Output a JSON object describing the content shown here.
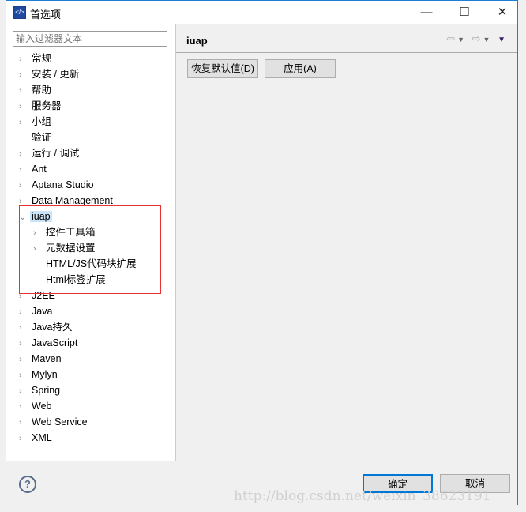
{
  "window": {
    "title": "首选项",
    "minimize": "—",
    "maximize": "☐",
    "close": "✕"
  },
  "filter": {
    "placeholder": "输入过滤器文本"
  },
  "tree": [
    {
      "label": "常规",
      "arrow": "›",
      "level": 0
    },
    {
      "label": "安装 / 更新",
      "arrow": "›",
      "level": 0
    },
    {
      "label": "帮助",
      "arrow": "›",
      "level": 0
    },
    {
      "label": "服务器",
      "arrow": "›",
      "level": 0
    },
    {
      "label": "小组",
      "arrow": "›",
      "level": 0
    },
    {
      "label": "验证",
      "arrow": "",
      "level": 0
    },
    {
      "label": "运行 / 调试",
      "arrow": "›",
      "level": 0
    },
    {
      "label": "Ant",
      "arrow": "›",
      "level": 0
    },
    {
      "label": "Aptana Studio",
      "arrow": "›",
      "level": 0
    },
    {
      "label": "Data Management",
      "arrow": "›",
      "level": 0
    },
    {
      "label": "iuap",
      "arrow": "⌄",
      "level": 0,
      "selected": true
    },
    {
      "label": "控件工具箱",
      "arrow": "›",
      "level": 1
    },
    {
      "label": "元数据设置",
      "arrow": "›",
      "level": 1
    },
    {
      "label": "HTML/JS代码块扩展",
      "arrow": "",
      "level": 1
    },
    {
      "label": "Html标签扩展",
      "arrow": "",
      "level": 1
    },
    {
      "label": "J2EE",
      "arrow": "›",
      "level": 0
    },
    {
      "label": "Java",
      "arrow": "›",
      "level": 0
    },
    {
      "label": "Java持久",
      "arrow": "›",
      "level": 0
    },
    {
      "label": "JavaScript",
      "arrow": "›",
      "level": 0
    },
    {
      "label": "Maven",
      "arrow": "›",
      "level": 0
    },
    {
      "label": "Mylyn",
      "arrow": "›",
      "level": 0
    },
    {
      "label": "Spring",
      "arrow": "›",
      "level": 0
    },
    {
      "label": "Web",
      "arrow": "›",
      "level": 0
    },
    {
      "label": "Web Service",
      "arrow": "›",
      "level": 0
    },
    {
      "label": "XML",
      "arrow": "›",
      "level": 0
    }
  ],
  "page": {
    "title": "iuap",
    "restore_defaults": "恢复默认值(D)",
    "apply": "应用(A)"
  },
  "footer": {
    "help": "?",
    "ok": "确定",
    "cancel": "取消"
  },
  "watermark": "http://blog.csdn.net/weixin_38623191",
  "colors": {
    "accent": "#1a7fd6",
    "highlight_box": "#e53333",
    "selection": "#cce4f7"
  }
}
